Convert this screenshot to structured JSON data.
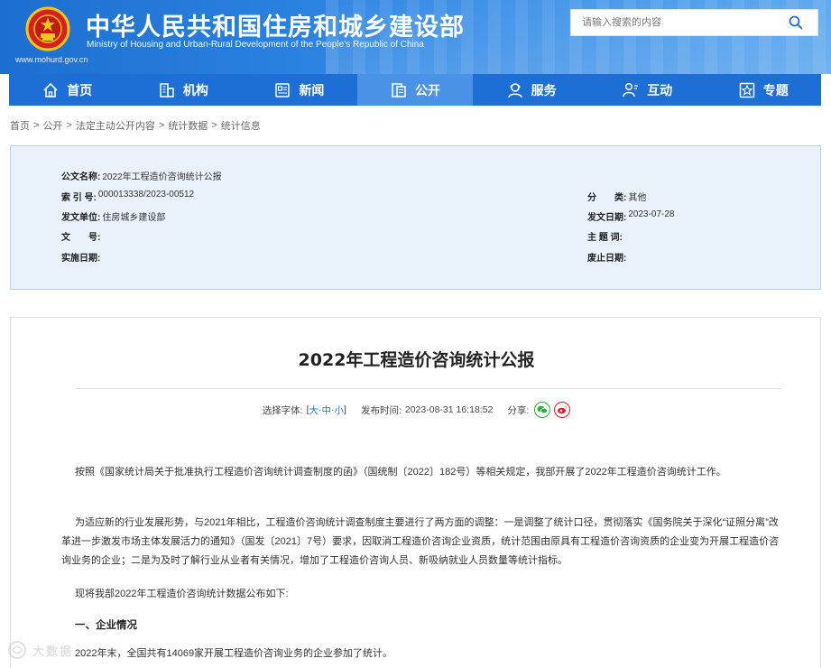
{
  "header": {
    "site_title": "中华人民共和国住房和城乡建设部",
    "site_subtitle": "Ministry of Housing and Urban-Rural Development of the People’s Republic of China",
    "site_url": "www.mohurd.gov.cn",
    "search_placeholder": "请输入搜索的内容",
    "brand_color": "#1d6fd6"
  },
  "nav": {
    "items": [
      {
        "label": "首页",
        "icon": "home-icon"
      },
      {
        "label": "机构",
        "icon": "building-icon"
      },
      {
        "label": "新闻",
        "icon": "news-icon"
      },
      {
        "label": "公开",
        "icon": "document-icon",
        "active": true
      },
      {
        "label": "服务",
        "icon": "user-service-icon"
      },
      {
        "label": "互动",
        "icon": "interaction-icon"
      },
      {
        "label": "专题",
        "icon": "star-icon"
      }
    ]
  },
  "breadcrumb": [
    "首页",
    "公开",
    "法定主动公开内容",
    "统计数据",
    "统计信息"
  ],
  "breadcrumb_separator": ">",
  "meta": {
    "doc_name_label": "公文名称:",
    "doc_name": "2022年工程造价咨询统计公报",
    "index_label": "索 引 号:",
    "index": "000013338/2023-00512",
    "category_label": "分　　类:",
    "category": "其他",
    "issuer_label": "发文单位:",
    "issuer": "住房城乡建设部",
    "issue_date_label": "发文日期:",
    "issue_date": "2023-07-28",
    "doc_no_label": "文　　号:",
    "doc_no": "",
    "subject_label": "主 题 词:",
    "subject": "",
    "effective_label": "实施日期:",
    "effective": "",
    "expiry_label": "废止日期:",
    "expiry": ""
  },
  "article": {
    "title": "2022年工程造价咨询统计公报",
    "font_size_label": "选择字体:",
    "font_size_open": "[",
    "size_large": "大",
    "size_medium": "中",
    "size_small": "小",
    "font_size_close": "]",
    "size_dash": "·",
    "publish_label": "发布时间:",
    "publish_time": "2023-08-31 16:18:52",
    "share_label": "分享:",
    "paragraphs": [
      "按照《国家统计局关于批准执行工程造价咨询统计调查制度的函》（国统制〔2022〕182号）等相关规定，我部开展了2022年工程造价咨询统计工作。",
      "为适应新的行业发展形势，与2021年相比，工程造价咨询统计调查制度主要进行了两方面的调整：一是调整了统计口径，贯彻落实《国务院关于深化“证照分离”改革进一步激发市场主体发展活力的通知》（国发〔2021〕7号）要求，因取消工程造价咨询企业资质，统计范围由原具有工程造价咨询资质的企业变为开展工程造价咨询业务的企业；二是为及时了解行业从业者有关情况，增加了工程造价咨询人员、新吸纳就业人员数量等统计指标。",
      "现将我部2022年工程造价咨询统计数据公布如下:"
    ],
    "section_heading": "一、企业情况",
    "last_paragraph": "2022年末，全国共有14069家开展工程造价咨询业务的企业参加了统计。"
  },
  "watermark": "大数据"
}
